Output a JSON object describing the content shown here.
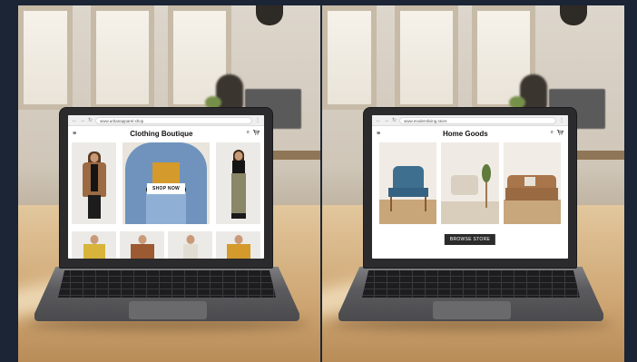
{
  "left_laptop": {
    "url": "www.urbanapparel.shop",
    "site_title": "Clothing Boutique",
    "cta_label": "SHOP NOW",
    "icons": [
      "menu-icon",
      "search-icon",
      "cart-icon"
    ]
  },
  "right_laptop": {
    "url": "www.modernliving.store",
    "site_title": "Home Goods",
    "cta_label": "BROWSE STORE",
    "icons": [
      "menu-icon",
      "search-icon",
      "cart-icon"
    ]
  },
  "browser_glyphs": {
    "back": "←",
    "forward": "→",
    "reload": "↻",
    "more": "⋮",
    "menu": "≡",
    "search": "⌕",
    "cart": "🛒"
  },
  "colors": {
    "background": "#1b2536",
    "mustard_top": "#d59a2c",
    "denim": "#6f93bd",
    "camel": "#9c6a43",
    "teal_chair": "#3f6f8e",
    "leather_sofa": "#a9754a"
  }
}
